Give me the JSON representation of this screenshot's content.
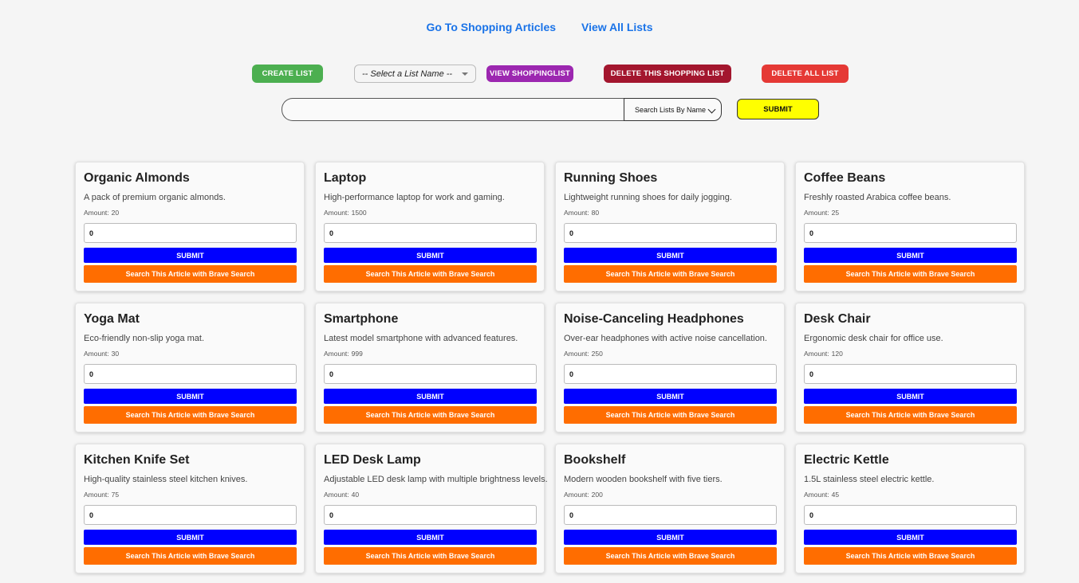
{
  "nav": {
    "articles_link": "Go To Shopping Articles",
    "all_lists_link": "View All Lists"
  },
  "controls": {
    "create_list": "CREATE LIST",
    "list_select_value": "-- Select a List Name --",
    "view_list": "VIEW SHOPPINGLIST",
    "delete_list": "DELETE THIS SHOPPING LIST",
    "delete_all": "DELETE ALL LIST"
  },
  "search": {
    "value": "",
    "mode": "Search Lists By Name",
    "submit": "SUBMIT"
  },
  "card_labels": {
    "amount": "Amount:",
    "submit": "SUBMIT",
    "search": "Search This Article with Brave Search"
  },
  "articles": [
    {
      "title": "Organic Almonds",
      "description": "A pack of premium organic almonds.",
      "amount": "20",
      "input": "0"
    },
    {
      "title": "Laptop",
      "description": "High-performance laptop for work and gaming.",
      "amount": "1500",
      "input": "0"
    },
    {
      "title": "Running Shoes",
      "description": "Lightweight running shoes for daily jogging.",
      "amount": "80",
      "input": "0"
    },
    {
      "title": "Coffee Beans",
      "description": "Freshly roasted Arabica coffee beans.",
      "amount": "25",
      "input": "0"
    },
    {
      "title": "Yoga Mat",
      "description": "Eco-friendly non-slip yoga mat.",
      "amount": "30",
      "input": "0"
    },
    {
      "title": "Smartphone",
      "description": "Latest model smartphone with advanced features.",
      "amount": "999",
      "input": "0"
    },
    {
      "title": "Noise-Canceling Headphones",
      "description": "Over-ear headphones with active noise cancellation.",
      "amount": "250",
      "input": "0"
    },
    {
      "title": "Desk Chair",
      "description": "Ergonomic desk chair for office use.",
      "amount": "120",
      "input": "0"
    },
    {
      "title": "Kitchen Knife Set",
      "description": "High-quality stainless steel kitchen knives.",
      "amount": "75",
      "input": "0"
    },
    {
      "title": "LED Desk Lamp",
      "description": "Adjustable LED desk lamp with multiple brightness levels.",
      "amount": "40",
      "input": "0"
    },
    {
      "title": "Bookshelf",
      "description": "Modern wooden bookshelf with five tiers.",
      "amount": "200",
      "input": "0"
    },
    {
      "title": "Electric Kettle",
      "description": "1.5L stainless steel electric kettle.",
      "amount": "45",
      "input": "0"
    }
  ]
}
